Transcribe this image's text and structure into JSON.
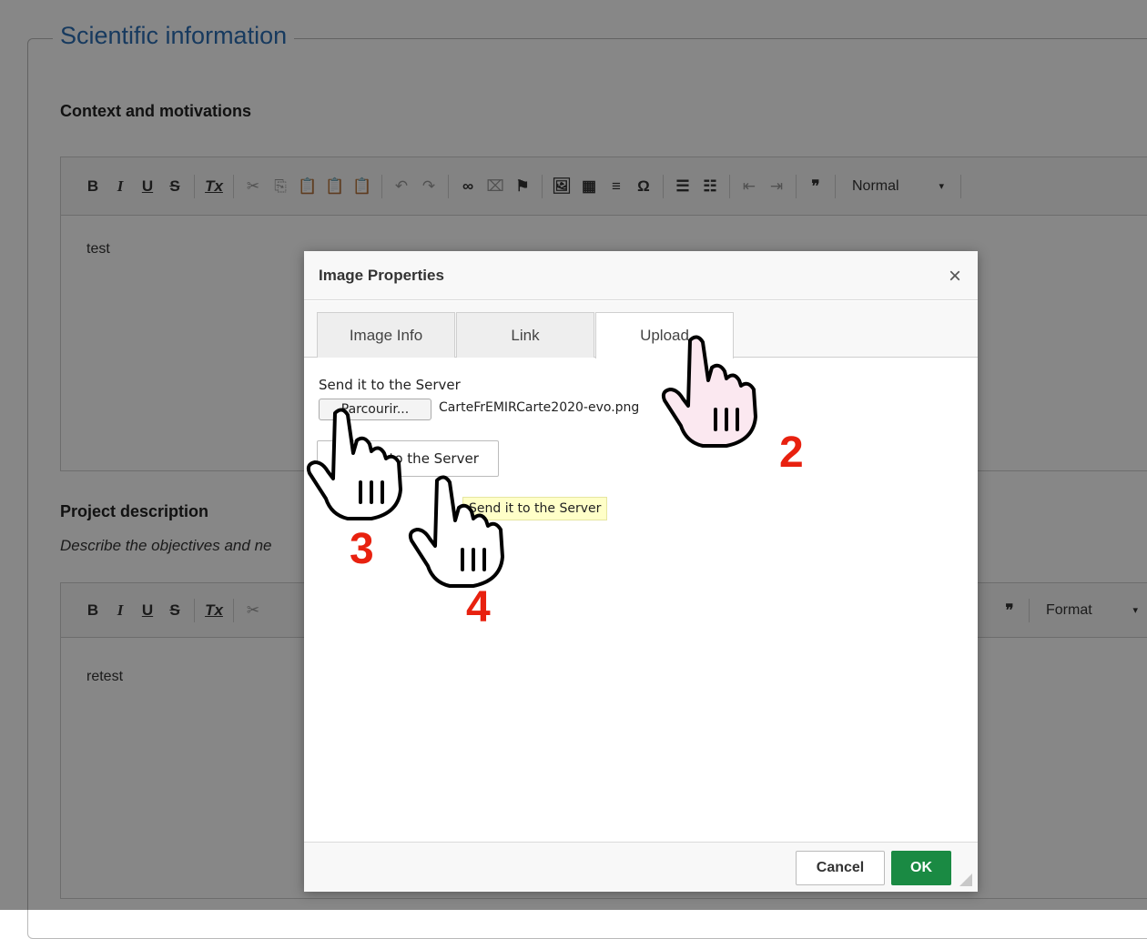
{
  "section": {
    "title": "Scientific information"
  },
  "context": {
    "label": "Context and motivations",
    "content": "test",
    "format_combo": "Normal"
  },
  "project": {
    "label": "Project description",
    "hint": "Describe the objectives and ne",
    "content": "retest",
    "format_combo": "Format"
  },
  "toolbar": {
    "bold": "B",
    "italic": "I",
    "underline": "U",
    "strike": "S",
    "remove_format": "Tx",
    "cut": "✂",
    "copy": "⎘",
    "paste": "📋",
    "paste_text": "📋",
    "paste_word": "📋",
    "undo": "↶",
    "redo": "↷",
    "link": "∞",
    "unlink": "⌧",
    "anchor": "⚑",
    "image": "🖼",
    "table": "▦",
    "hr": "≡",
    "special_char": "Ω",
    "numbered_list": "☰",
    "bullet_list": "☷",
    "outdent": "⇤",
    "indent": "⇥",
    "blockquote": "❞",
    "caret": "▾"
  },
  "dialog": {
    "title": "Image Properties",
    "close": "×",
    "tabs": [
      "Image Info",
      "Link",
      "Upload"
    ],
    "upload_label": "Send it to the Server",
    "browse_button": "Parcourir...",
    "file_name": "CarteFrEMIRCarte2020-evo.png",
    "send_button": "Send it to the Server",
    "tooltip": "Send it to the Server",
    "cancel": "Cancel",
    "ok": "OK"
  },
  "annotations": {
    "step2": "2",
    "step3": "3",
    "step4": "4"
  },
  "colors": {
    "accent": "#2c6fb3",
    "ok_green": "#1a8a43",
    "step_red": "#e8210f",
    "tooltip_bg": "#ffffc8"
  },
  "icons": [
    "hand-pointer-icon",
    "close-icon",
    "dropdown-caret-icon",
    "resize-grip-icon"
  ]
}
